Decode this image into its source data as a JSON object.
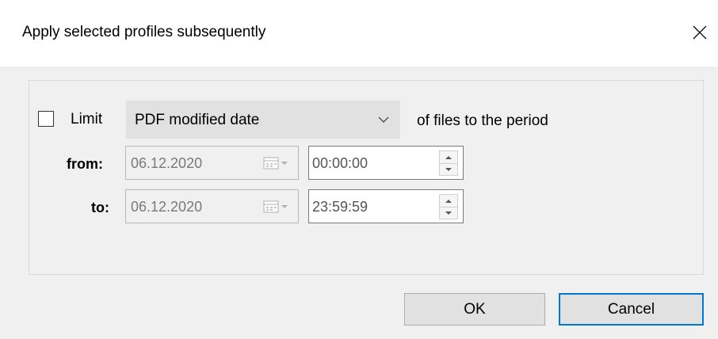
{
  "dialog": {
    "title": "Apply selected profiles subsequently"
  },
  "limit": {
    "checked": false,
    "label": "Limit",
    "selected_option": "PDF modified date",
    "period_text": "of files to the period"
  },
  "from": {
    "label": "from:",
    "date": "06.12.2020",
    "time": "00:00:00"
  },
  "to": {
    "label": "to:",
    "date": "06.12.2020",
    "time": "23:59:59"
  },
  "buttons": {
    "ok_label": "OK",
    "cancel_label": "Cancel"
  },
  "colors": {
    "focus_border": "#0078d7",
    "disabled_text": "#7a7a7a"
  },
  "icons": {
    "close": "close-icon",
    "dropdown": "chevron-down-icon",
    "calendar": "calendar-icon",
    "spin_up": "spin-up-arrow-icon",
    "spin_down": "spin-down-arrow-icon"
  }
}
